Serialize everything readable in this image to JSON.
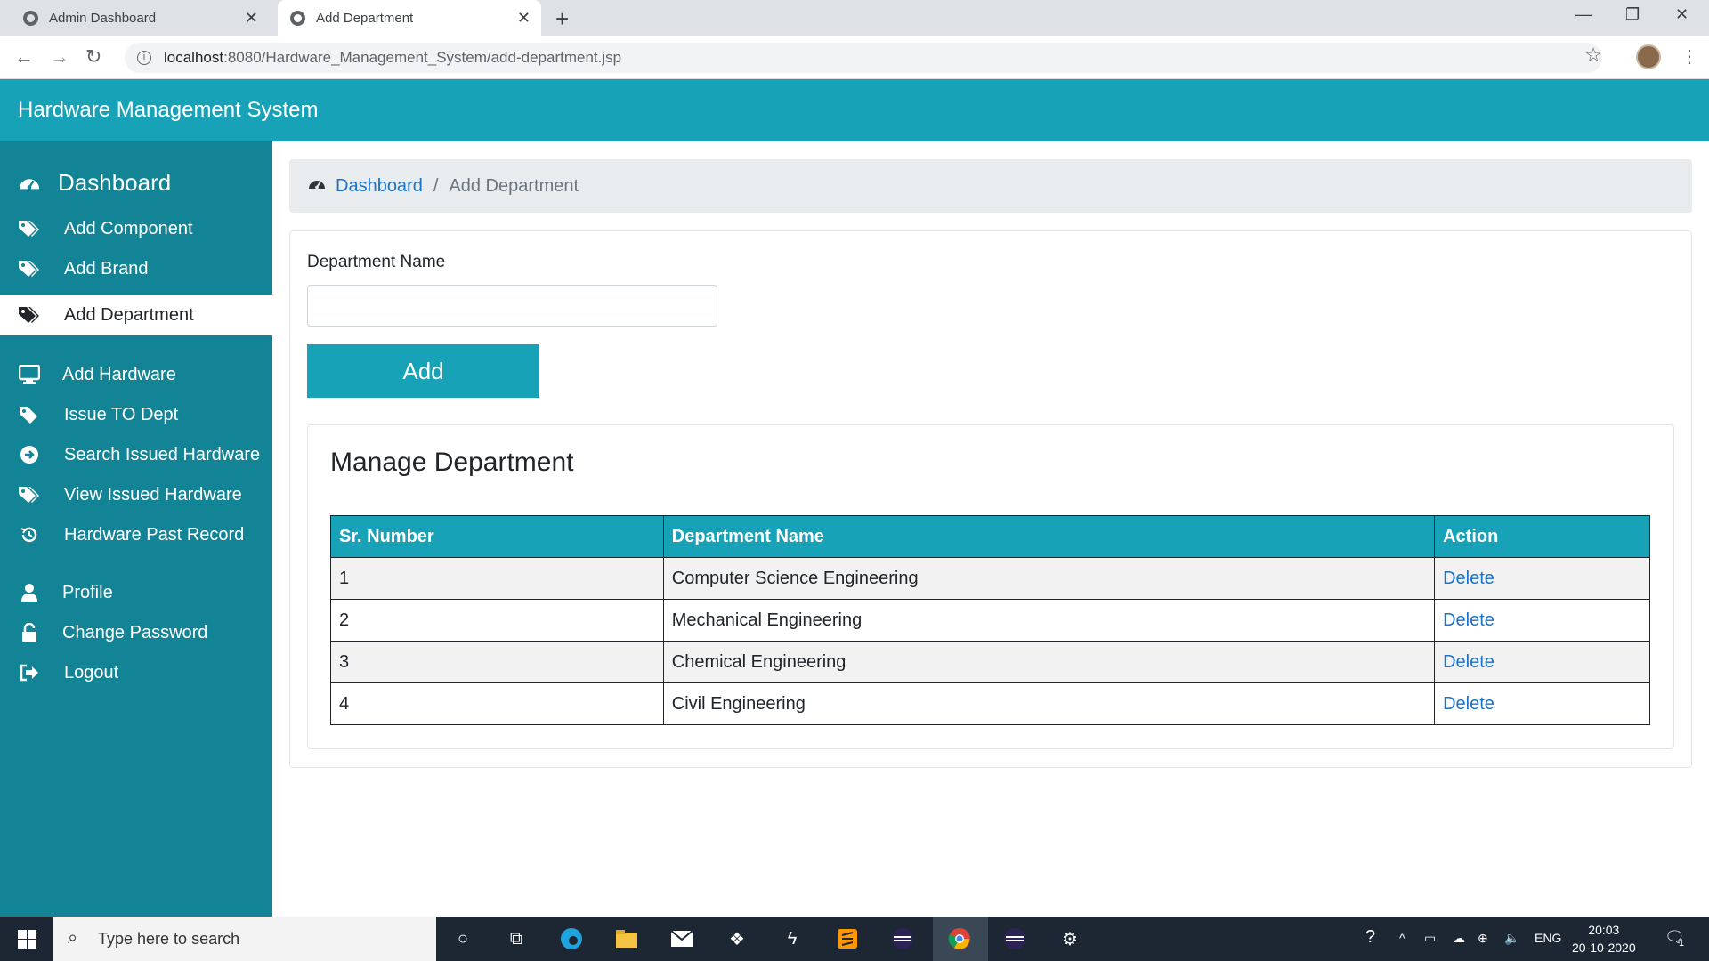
{
  "browser": {
    "tabs": [
      {
        "label": "Admin Dashboard",
        "active": false
      },
      {
        "label": "Add Department",
        "active": true
      }
    ],
    "new_tab": "+",
    "url_host": "localhost",
    "url_path": ":8080/Hardware_Management_System/add-department.jsp"
  },
  "app": {
    "title": "Hardware Management System"
  },
  "sidebar": {
    "items": [
      {
        "label": "Dashboard",
        "icon": "tachometer-icon"
      },
      {
        "label": "Add Component",
        "icon": "tags-icon"
      },
      {
        "label": "Add Brand",
        "icon": "tags-icon"
      },
      {
        "label": "Add Department",
        "icon": "tags-icon",
        "active": true
      },
      {
        "label": "Add Hardware",
        "icon": "desktop-icon"
      },
      {
        "label": "Issue TO Dept",
        "icon": "tag-icon"
      },
      {
        "label": "Search Issued Hardware",
        "icon": "arrow-circle-right-icon"
      },
      {
        "label": "View Issued Hardware",
        "icon": "tags-icon"
      },
      {
        "label": "Hardware Past Record",
        "icon": "history-icon"
      },
      {
        "label": "Profile",
        "icon": "user-icon"
      },
      {
        "label": "Change Password",
        "icon": "unlock-icon"
      },
      {
        "label": "Logout",
        "icon": "sign-out-icon"
      }
    ]
  },
  "breadcrumb": {
    "home": "Dashboard",
    "separator": "/",
    "current": "Add Department"
  },
  "form": {
    "label": "Department Name",
    "value": "",
    "button": "Add"
  },
  "manage": {
    "title": "Manage Department",
    "columns": [
      "Sr. Number",
      "Department Name",
      "Action"
    ],
    "rows": [
      {
        "sr": "1",
        "name": "Computer Science Engineering",
        "action": "Delete"
      },
      {
        "sr": "2",
        "name": "Mechanical Engineering",
        "action": "Delete"
      },
      {
        "sr": "3",
        "name": "Chemical Engineering",
        "action": "Delete"
      },
      {
        "sr": "4",
        "name": "Civil Engineering",
        "action": "Delete"
      }
    ]
  },
  "taskbar": {
    "search_placeholder": "Type here to search",
    "lang": "ENG",
    "time": "20:03",
    "date": "20-10-2020",
    "notifications": "1"
  },
  "colors": {
    "header": "#17a2b8",
    "sidebar": "#138496",
    "link": "#1a73c8"
  }
}
